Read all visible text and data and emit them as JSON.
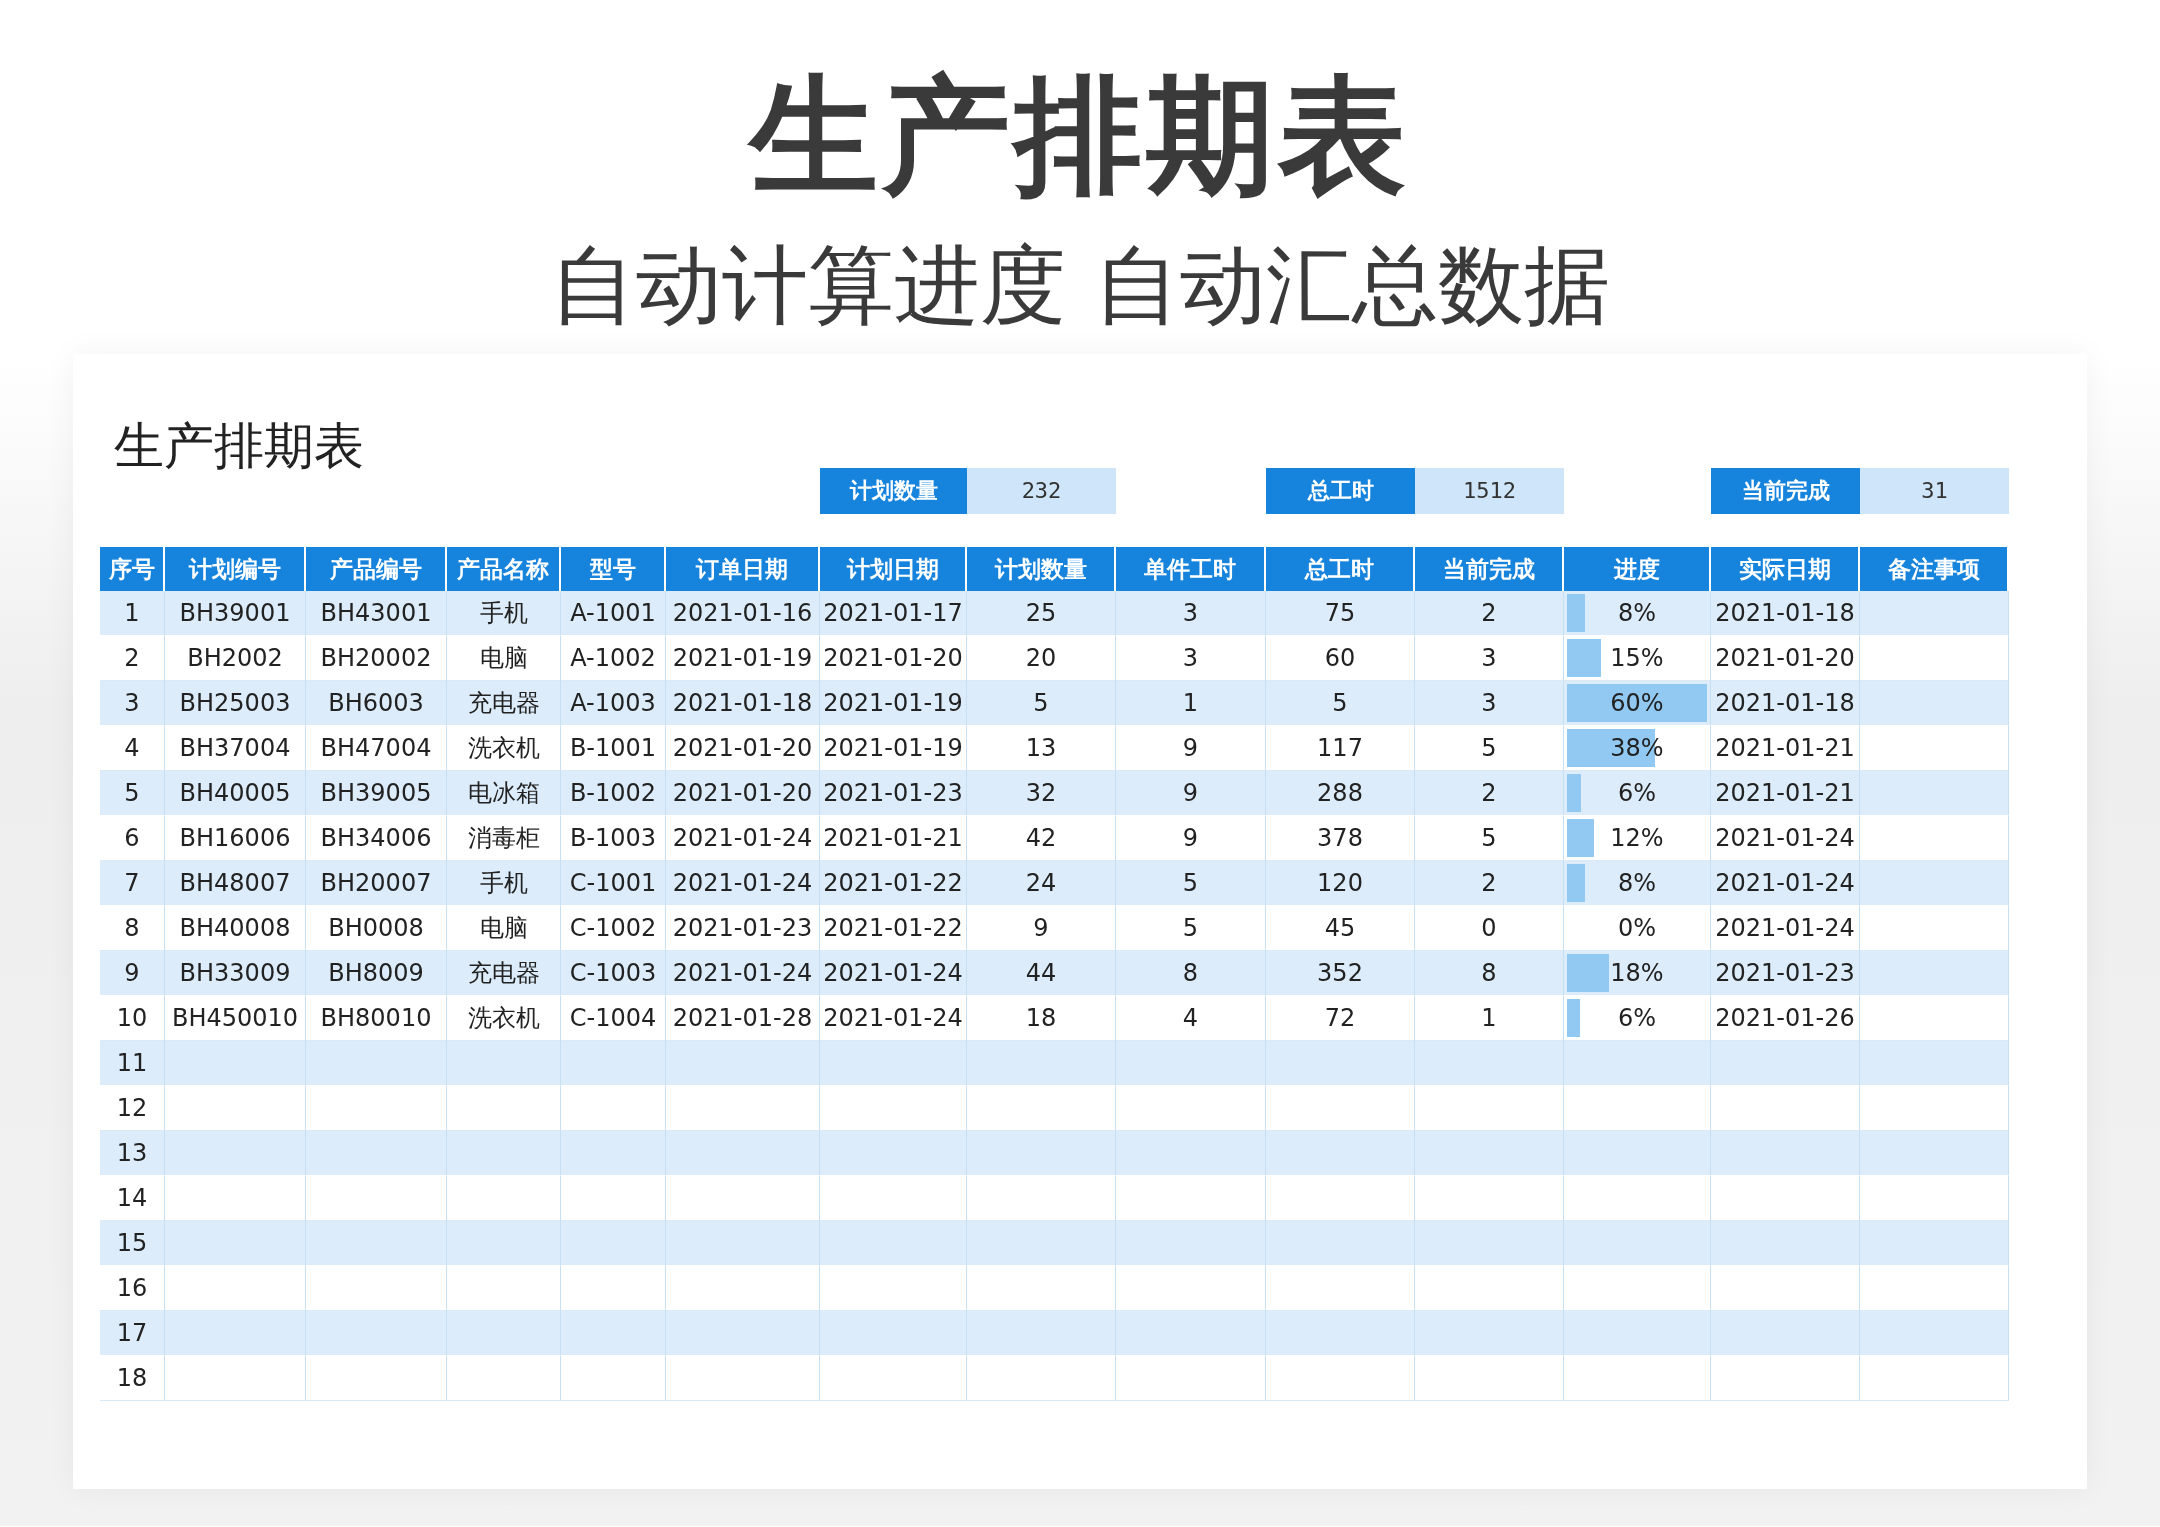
{
  "headline": "生产排期表",
  "subtitle": "自动计算进度 自动汇总数据",
  "sheet": {
    "title": "生产排期表",
    "summary": [
      {
        "label": "计划数量",
        "value": "232"
      },
      {
        "label": "总工时",
        "value": "1512"
      },
      {
        "label": "当前完成",
        "value": "31"
      }
    ],
    "columns": [
      {
        "label": "序号",
        "kind": "text"
      },
      {
        "label": "计划编号",
        "kind": "text"
      },
      {
        "label": "产品编号",
        "kind": "text"
      },
      {
        "label": "产品名称",
        "kind": "text"
      },
      {
        "label": "型号",
        "kind": "text"
      },
      {
        "label": "订单日期",
        "kind": "text"
      },
      {
        "label": "计划日期",
        "kind": "text"
      },
      {
        "label": "计划数量",
        "kind": "text"
      },
      {
        "label": "单件工时",
        "kind": "text"
      },
      {
        "label": "总工时",
        "kind": "text"
      },
      {
        "label": "当前完成",
        "kind": "text"
      },
      {
        "label": "进度",
        "kind": "progress"
      },
      {
        "label": "实际日期",
        "kind": "text"
      },
      {
        "label": "备注事项",
        "kind": "text"
      }
    ],
    "rows": [
      {
        "cells": [
          "1",
          "BH39001",
          "BH43001",
          "手机",
          "A-1001",
          "2021-01-16",
          "2021-01-17",
          "25",
          "3",
          "75",
          "2",
          "8%",
          "2021-01-18"
        ],
        "level": 0.13
      },
      {
        "cells": [
          "2",
          "BH2002",
          "BH20002",
          "电脑",
          "A-1002",
          "2021-01-19",
          "2021-01-20",
          "20",
          "3",
          "60",
          "3",
          "15%",
          "2021-01-20"
        ],
        "level": 0.24
      },
      {
        "cells": [
          "3",
          "BH25003",
          "BH6003",
          "充电器",
          "A-1003",
          "2021-01-18",
          "2021-01-19",
          "5",
          "1",
          "5",
          "3",
          "60%",
          "2021-01-18"
        ],
        "level": 1
      },
      {
        "cells": [
          "4",
          "BH37004",
          "BH47004",
          "洗衣机",
          "B-1001",
          "2021-01-20",
          "2021-01-19",
          "13",
          "9",
          "117",
          "5",
          "38%",
          "2021-01-21"
        ],
        "level": 0.63
      },
      {
        "cells": [
          "5",
          "BH40005",
          "BH39005",
          "电冰箱",
          "B-1002",
          "2021-01-20",
          "2021-01-23",
          "32",
          "9",
          "288",
          "2",
          "6%",
          "2021-01-21"
        ],
        "level": 0.1
      },
      {
        "cells": [
          "6",
          "BH16006",
          "BH34006",
          "消毒柜",
          "B-1003",
          "2021-01-24",
          "2021-01-21",
          "42",
          "9",
          "378",
          "5",
          "12%",
          "2021-01-24"
        ],
        "level": 0.19
      },
      {
        "cells": [
          "7",
          "BH48007",
          "BH20007",
          "手机",
          "C-1001",
          "2021-01-24",
          "2021-01-22",
          "24",
          "5",
          "120",
          "2",
          "8%",
          "2021-01-24"
        ],
        "level": 0.13
      },
      {
        "cells": [
          "8",
          "BH40008",
          "BH0008",
          "电脑",
          "C-1002",
          "2021-01-23",
          "2021-01-22",
          "9",
          "5",
          "45",
          "0",
          "0%",
          "2021-01-24"
        ]
      },
      {
        "cells": [
          "9",
          "BH33009",
          "BH8009",
          "充电器",
          "C-1003",
          "2021-01-24",
          "2021-01-24",
          "44",
          "8",
          "352",
          "8",
          "18%",
          "2021-01-23"
        ],
        "level": 0.3
      },
      {
        "cells": [
          "10",
          "BH450010",
          "BH80010",
          "洗衣机",
          "C-1004",
          "2021-01-28",
          "2021-01-24",
          "18",
          "4",
          "72",
          "1",
          "6%",
          "2021-01-26"
        ],
        "level": 0.09
      },
      {
        "cells": [
          "11"
        ]
      },
      {
        "cells": [
          "12"
        ]
      },
      {
        "cells": [
          "13"
        ]
      },
      {
        "cells": [
          "14"
        ]
      },
      {
        "cells": [
          "15"
        ]
      },
      {
        "cells": [
          "16"
        ]
      },
      {
        "cells": [
          "17"
        ]
      },
      {
        "cells": [
          "18"
        ]
      }
    ]
  }
}
